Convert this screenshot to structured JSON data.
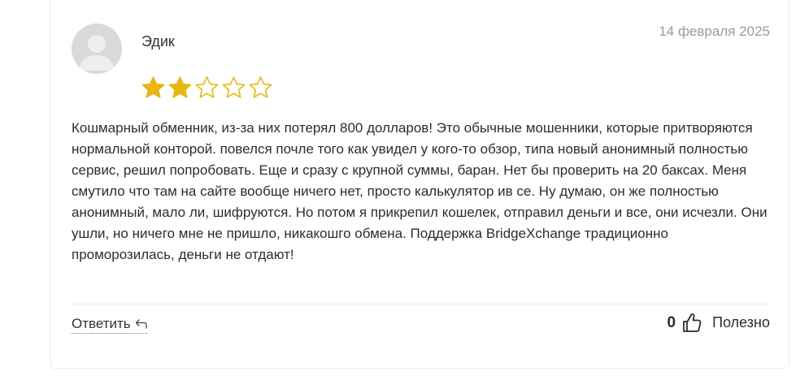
{
  "review": {
    "author": "Эдик",
    "date": "14 февраля 2025",
    "rating": 2,
    "max_rating": 5,
    "text": "Кошмарный обменник, из-за них потерял 800 долларов! Это обычные мошенники, которые притворяются нормальной конторой. повелся почле того как увидел у кого-то обзор, типа новый анонимный полностью сервис, решил попробовать. Еще и сразу с крупной суммы, баран. Нет бы проверить на 20 баксах. Меня смутило что там на сайте вообще ничего нет, просто калькулятор ив се. Ну думаю, он же полностью анонимный, мало ли, шифруются. Но потом я прикрепил кошелек, отправил деньги и все, они исчезли. Они ушли, но ничего мне не пришло, никакошго обмена. Поддержка BridgeXchange традиционно проморозилась, деньги не отдают!"
  },
  "actions": {
    "reply_label": "Ответить",
    "helpful_count": "0",
    "helpful_label": "Полезно"
  },
  "icons": {
    "avatar": "user-avatar-placeholder",
    "star": "star-icon",
    "reply": "reply-arrow-icon",
    "like": "thumbs-up-icon"
  },
  "colors": {
    "star_filled": "#e8b712",
    "star_empty_stroke": "#e8b712",
    "date_text": "#9a9a9a",
    "divider": "#ececec"
  }
}
